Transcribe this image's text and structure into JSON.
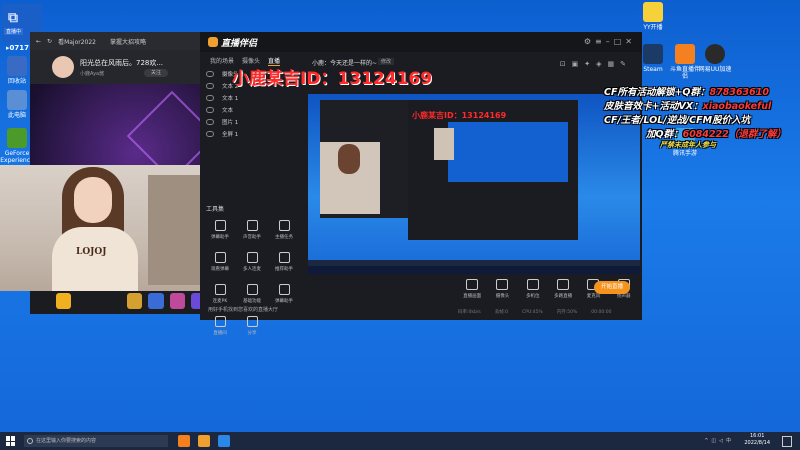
{
  "desktop": {
    "top_left": {
      "badge": "直播中",
      "fps": "0717"
    },
    "left_icons": [
      {
        "label": "回收站",
        "color": "#3a6bc4"
      },
      {
        "label": "此电脑",
        "color": "#5a8fd6"
      },
      {
        "label": "GeForce Experience",
        "color": "#4b9a2a"
      }
    ],
    "right_icons": [
      {
        "label": "YY开播",
        "color": "#f6d13a"
      },
      {
        "label": "Steam",
        "color": "#1b3a66"
      },
      {
        "label": "斗鱼直播伴侣",
        "color": "#f5801f"
      },
      {
        "label": "网易UU加速",
        "color": "#2a2a2a"
      },
      {
        "label": "腾讯手游",
        "color": "#3aa4f0"
      }
    ]
  },
  "browser": {
    "tab_title": "看Major2022",
    "tab2": "掌握大招攻略",
    "anchor_title": "阳光总在风雨后。728欢...",
    "anchor_sub": "小鹿Aya酱",
    "follow_label": "关注"
  },
  "camera": {
    "shirt_text": "LOJOJ"
  },
  "app": {
    "title": "直播伴侣",
    "tabs": [
      "我的场景",
      "摄像头",
      "直播"
    ],
    "active_tab": 2,
    "room_title": "小鹿：今天还是一样的~",
    "room_edit": "修改",
    "scenes": [
      "摄像头 2",
      "文本 2",
      "文本 1",
      "文本",
      "图片 1",
      "全屏 1"
    ],
    "tools_title": "工具集",
    "tools": [
      "弹幕助手",
      "声音助手",
      "主播任务",
      "观看弹幕",
      "多人连麦",
      "推荐助手",
      "连麦PK",
      "基础功能",
      "弹幕助手",
      "直播间",
      "分享"
    ],
    "phone_hint": "用好手机找到您喜欢的直播大厅",
    "controls": [
      "直播画面",
      "摄像头",
      "多机位",
      "多路直播",
      "麦克风",
      "扬声器"
    ],
    "start_label": "开始直播",
    "status": [
      "码率:0kb/s",
      "丢帧:0",
      "CPU:45%",
      "内存:50%",
      "00:00:00"
    ]
  },
  "overlay": {
    "id_text": "小鹿某吉ID：13124169",
    "id_text_small": "小鹿某吉ID：13124169",
    "promo": [
      {
        "prefix": "CF所有活动解锁+Q群：",
        "value": "878363610"
      },
      {
        "prefix": "皮肤音效卡+活动VX：",
        "value": "xiaobaokeful"
      },
      {
        "prefix": "CF/王者/LOL/逆战/CFM股价入坑",
        "value": ""
      },
      {
        "prefix": "加Q群：",
        "value": "6084222（退群了解）"
      }
    ],
    "promo_minor": "严禁未成年人参与"
  },
  "taskbar": {
    "search_placeholder": "在这里输入你要搜索的内容",
    "time": "16:01",
    "date": "2022/8/14"
  }
}
